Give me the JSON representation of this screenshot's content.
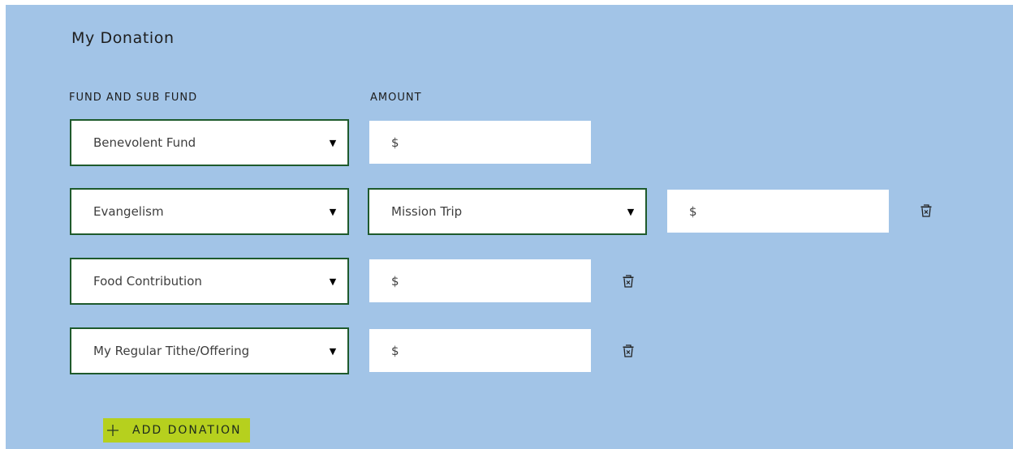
{
  "title": "My Donation",
  "columns": {
    "fund": "FUND AND SUB FUND",
    "amount": "AMOUNT"
  },
  "rows": [
    {
      "fund": "Benevolent Fund",
      "currency": "$"
    },
    {
      "fund": "Evangelism",
      "sub_fund": "Mission Trip",
      "currency": "$"
    },
    {
      "fund": "Food Contribution",
      "currency": "$"
    },
    {
      "fund": "My Regular Tithe/Offering",
      "currency": "$"
    }
  ],
  "caret": "▼",
  "add_donation": {
    "icon": "plus-icon",
    "label": "ADD DONATION"
  },
  "colors": {
    "panel_background": "#a2c4e7",
    "field_border": "#1e5a2c",
    "add_highlight": "#b6d01e"
  }
}
